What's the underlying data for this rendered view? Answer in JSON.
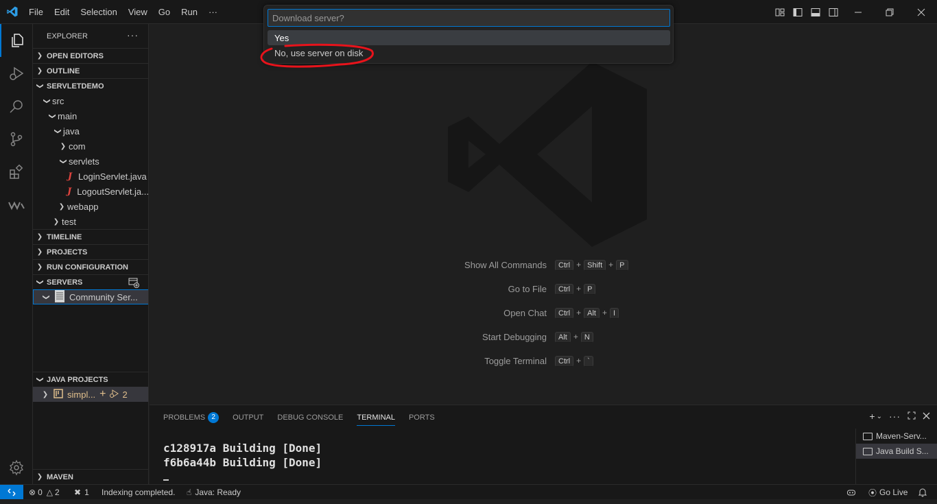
{
  "menu": [
    "File",
    "Edit",
    "Selection",
    "View",
    "Go",
    "Run",
    "···"
  ],
  "explorer": {
    "title": "EXPLORER",
    "more": "···",
    "sections": {
      "open_editors": "OPEN EDITORS",
      "outline": "OUTLINE",
      "project": "SERVLETDEMO",
      "timeline": "TIMELINE",
      "projects": "PROJECTS",
      "run_configuration": "RUN CONFIGURATION",
      "servers": "SERVERS",
      "java_projects": "JAVA PROJECTS",
      "maven": "MAVEN"
    },
    "tree": {
      "src": "src",
      "main": "main",
      "java": "java",
      "com": "com",
      "servlets": "servlets",
      "file1": "LoginServlet.java",
      "file2": "LogoutServlet.ja...",
      "webapp": "webapp",
      "test": "test"
    },
    "server_item": "Community Ser...",
    "java_project_item": "simpl...",
    "java_project_count": "2"
  },
  "quick_pick": {
    "placeholder": "Download server?",
    "options": [
      "Yes",
      "No, use server on disk"
    ]
  },
  "shortcuts": [
    {
      "label": "Show All Commands",
      "keys": [
        "Ctrl",
        "Shift",
        "P"
      ]
    },
    {
      "label": "Go to File",
      "keys": [
        "Ctrl",
        "P"
      ]
    },
    {
      "label": "Open Chat",
      "keys": [
        "Ctrl",
        "Alt",
        "I"
      ]
    },
    {
      "label": "Start Debugging",
      "keys": [
        "Alt",
        "N"
      ]
    },
    {
      "label": "Toggle Terminal",
      "keys": [
        "Ctrl",
        "`"
      ]
    }
  ],
  "panel": {
    "tabs": [
      "PROBLEMS",
      "OUTPUT",
      "DEBUG CONSOLE",
      "TERMINAL",
      "PORTS"
    ],
    "problems_count": "2",
    "active_tab": "TERMINAL",
    "terminal_lines": [
      "c128917a Building [Done]",
      "f6b6a44b Building [Done]"
    ],
    "terminals": [
      "Maven-Serv...",
      "Java Build S..."
    ]
  },
  "status": {
    "errors": "0",
    "warnings": "2",
    "ports": "1",
    "message": "Indexing completed.",
    "java": "Java: Ready",
    "golive": "Go Live"
  },
  "colors": {
    "accent": "#0078d4",
    "annotation": "#e8131b"
  }
}
